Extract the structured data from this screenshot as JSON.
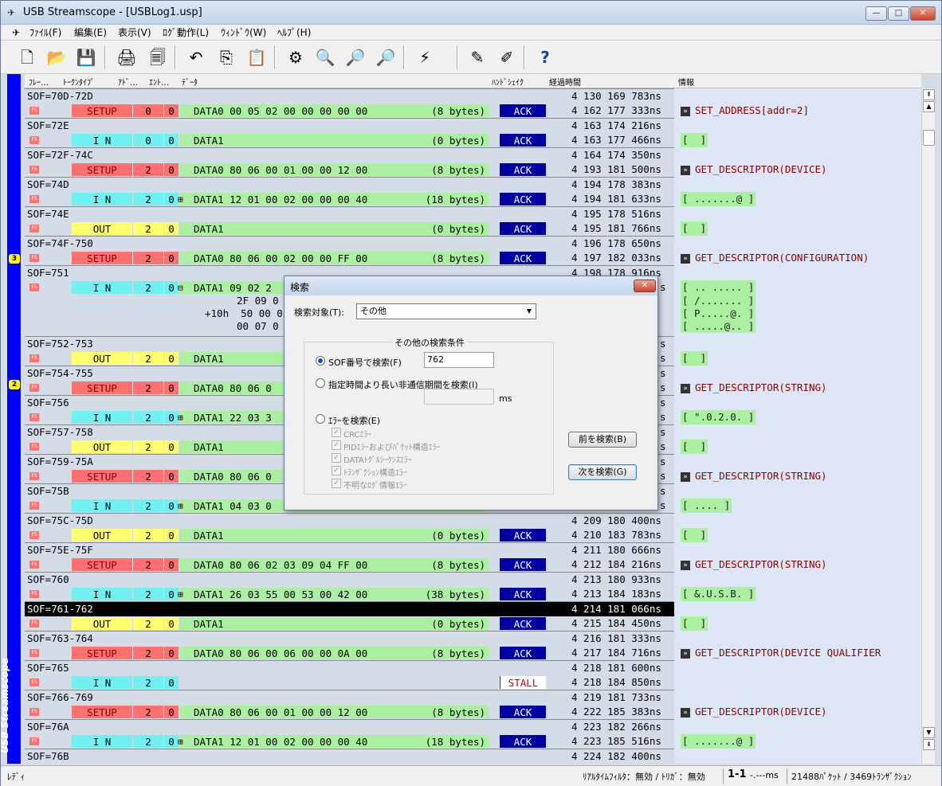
{
  "window": {
    "title": "USB Streamscope - [USBLog1.usp]",
    "min": "—",
    "max": "□",
    "close": "✕"
  },
  "menu": [
    "ﾌｧｲﾙ(F)",
    "編集(E)",
    "表示(V)",
    "ﾛｸﾞ動作(L)",
    "ｳｨﾝﾄﾞｳ(W)",
    "ﾍﾙﾌﾟ(H)"
  ],
  "mdi": {
    "min": "_",
    "restore": "❐",
    "close": "×"
  },
  "toolbar": {
    "icons": [
      "new-icon",
      "open-icon",
      "save-icon",
      "print-icon",
      "print-preview-icon",
      "undo-icon",
      "copy-icon",
      "paste-icon",
      "settings-icon",
      "search-icon",
      "find-prev-icon",
      "find-next-icon",
      "trigger-icon",
      "start-log-icon",
      "stop-log-icon",
      "help-icon"
    ],
    "glyphs": [
      "🗋",
      "📂",
      "💾",
      "🖨",
      "🗐",
      "↶",
      "⎘",
      "📋",
      "⚙",
      "🔍",
      "🔎",
      "🔎",
      "⚡",
      "✎",
      "✐",
      "?"
    ]
  },
  "sidebar": {
    "label": "USB Streamscope",
    "marks": [
      "3",
      "2"
    ]
  },
  "columns": [
    "ﾌﾚｰ…",
    "ﾄｰｸﾝﾀｲﾌﾟ",
    "ｱﾄﾞ…",
    "ｴﾝﾄ…",
    "ﾃﾞｰﾀ",
    "ﾊﾝﾄﾞｼｪｲｸ",
    "経過時間",
    "情報"
  ],
  "fs_label": "FS",
  "rows": [
    {
      "sof": "SOF=70D-72D",
      "t1": "4 130 169 783ns",
      "pid": "SETUP",
      "addr": "0",
      "endp": "0",
      "data": "DATA0 00 05 02 00 00 00 00 00",
      "len": "(8 bytes)",
      "hs": "ACK",
      "t2": "4 162 177 333ns",
      "info": "SET_ADDRESS[addr=2]",
      "kind": "req"
    },
    {
      "sof": "SOF=72E",
      "t1": "4 163 174 216ns",
      "pid": "I N",
      "addr": "0",
      "endp": "0",
      "data": "DATA1",
      "len": "(0 bytes)",
      "hs": "ACK",
      "t2": "4 163 177 466ns",
      "info": "[  ]",
      "kind": "bytes"
    },
    {
      "sof": "SOF=72F-74C",
      "t1": "4 164 174 350ns",
      "pid": "SETUP",
      "addr": "2",
      "endp": "0",
      "data": "DATA0 80 06 00 01 00 00 12 00",
      "len": "(8 bytes)",
      "hs": "ACK",
      "t2": "4 193 181 500ns",
      "info": "GET_DESCRIPTOR(DEVICE)",
      "kind": "req"
    },
    {
      "sof": "SOF=74D",
      "t1": "4 194 178 383ns",
      "pid": "I N",
      "addr": "2",
      "endp": "0",
      "data": "DATA1 12 01 00 02 00 00 00 40",
      "len": "(18 bytes)",
      "hs": "ACK",
      "t2": "4 194 181 633ns",
      "info": "[ .......@ ]",
      "kind": "bytes",
      "exp": "⊞"
    },
    {
      "sof": "SOF=74E",
      "t1": "4 195 178 516ns",
      "pid": "OUT",
      "addr": "2",
      "endp": "0",
      "data": "DATA1",
      "len": "(0 bytes)",
      "hs": "ACK",
      "t2": "4 195 181 766ns",
      "info": "[  ]",
      "kind": "bytes"
    },
    {
      "sof": "SOF=74F-750",
      "t1": "4 196 178 650ns",
      "pid": "SETUP",
      "addr": "2",
      "endp": "0",
      "data": "DATA0 80 06 00 02 00 00 FF 00",
      "len": "(8 bytes)",
      "hs": "ACK",
      "t2": "4 197 182 033ns",
      "info": "GET_DESCRIPTOR(CONFIGURATION)",
      "kind": "req"
    },
    {
      "sof": "SOF=751",
      "t1": "4 198 178 916ns",
      "pid": "I N",
      "addr": "2",
      "endp": "0",
      "data": "DATA1 09 02 2",
      "len": "",
      "hs": "",
      "t2": "s",
      "info": "[ .. ..... ]",
      "kind": "bytes",
      "exp": "⊟"
    },
    {
      "sof": "SOF=752-753",
      "t1": "s",
      "pid": "OUT",
      "addr": "2",
      "endp": "0",
      "data": "DATA1",
      "len": "",
      "hs": "",
      "t2": "s",
      "info": "[  ]",
      "kind": "bytes"
    },
    {
      "sof": "SOF=754-755",
      "t1": "s",
      "pid": "SETUP",
      "addr": "2",
      "endp": "0",
      "data": "DATA0 80 06 0",
      "len": "",
      "hs": "",
      "t2": "s",
      "info": "GET_DESCRIPTOR(STRING)",
      "kind": "req"
    },
    {
      "sof": "SOF=756",
      "t1": "s",
      "pid": "I N",
      "addr": "2",
      "endp": "0",
      "data": "DATA1 22 03 3",
      "len": "",
      "hs": "",
      "t2": "s",
      "info": "[ \".0.2.0. ]",
      "kind": "bytes",
      "exp": "⊞"
    },
    {
      "sof": "SOF=757-758",
      "t1": "s",
      "pid": "OUT",
      "addr": "2",
      "endp": "0",
      "data": "DATA1",
      "len": "",
      "hs": "",
      "t2": "s",
      "info": "[  ]",
      "kind": "bytes"
    },
    {
      "sof": "SOF=759-75A",
      "t1": "s",
      "pid": "SETUP",
      "addr": "2",
      "endp": "0",
      "data": "DATA0 80 06 0",
      "len": "",
      "hs": "",
      "t2": "s",
      "info": "GET_DESCRIPTOR(STRING)",
      "kind": "req"
    },
    {
      "sof": "SOF=75B",
      "t1": "s",
      "pid": "I N",
      "addr": "2",
      "endp": "0",
      "data": "DATA1 04 03 0",
      "len": "",
      "hs": "",
      "t2": "s",
      "info": "[ .... ]",
      "kind": "bytes",
      "exp": "⊞"
    },
    {
      "sof": "SOF=75C-75D",
      "t1": "4 209 180 400ns",
      "pid": "OUT",
      "addr": "2",
      "endp": "0",
      "data": "DATA1",
      "len": "(0 bytes)",
      "hs": "ACK",
      "t2": "4 210 183 783ns",
      "info": "[  ]",
      "kind": "bytes"
    },
    {
      "sof": "SOF=75E-75F",
      "t1": "4 211 180 666ns",
      "pid": "SETUP",
      "addr": "2",
      "endp": "0",
      "data": "DATA0 80 06 02 03 09 04 FF 00",
      "len": "(8 bytes)",
      "hs": "ACK",
      "t2": "4 212 184 216ns",
      "info": "GET_DESCRIPTOR(STRING)",
      "kind": "req"
    },
    {
      "sof": "SOF=760",
      "t1": "4 213 180 933ns",
      "pid": "I N",
      "addr": "2",
      "endp": "0",
      "data": "DATA1 26 03 55 00 53 00 42 00",
      "len": "(38 bytes)",
      "hs": "ACK",
      "t2": "4 213 184 183ns",
      "info": "[ &.U.S.B. ]",
      "kind": "bytes",
      "exp": "⊞"
    },
    {
      "sof": "SOF=761-762",
      "t1": "4 214 181 066ns",
      "pid": "OUT",
      "addr": "2",
      "endp": "0",
      "data": "DATA1",
      "len": "(0 bytes)",
      "hs": "ACK",
      "t2": "4 215 184 450ns",
      "info": "[  ]",
      "kind": "bytes",
      "sel": true
    },
    {
      "sof": "SOF=763-764",
      "t1": "4 216 181 333ns",
      "pid": "SETUP",
      "addr": "2",
      "endp": "0",
      "data": "DATA0 80 06 00 06 00 00 0A 00",
      "len": "(8 bytes)",
      "hs": "ACK",
      "t2": "4 217 184 716ns",
      "info": "GET_DESCRIPTOR(DEVICE QUALIFIER",
      "kind": "req"
    },
    {
      "sof": "SOF=765",
      "t1": "4 218 181 600ns",
      "pid": "I N",
      "addr": "2",
      "endp": "0",
      "data": "",
      "len": "",
      "hs": "STALL",
      "t2": "4 218 184 850ns",
      "info": "",
      "kind": "none"
    },
    {
      "sof": "SOF=766-769",
      "t1": "4 219 181 733ns",
      "pid": "SETUP",
      "addr": "2",
      "endp": "0",
      "data": "DATA0 80 06 00 01 00 00 12 00",
      "len": "(8 bytes)",
      "hs": "ACK",
      "t2": "4 222 185 383ns",
      "info": "GET_DESCRIPTOR(DEVICE)",
      "kind": "req"
    },
    {
      "sof": "SOF=76A",
      "t1": "4 223 182 266ns",
      "pid": "I N",
      "addr": "2",
      "endp": "0",
      "data": "DATA1 12 01 00 02 00 00 00 40",
      "len": "(18 bytes)",
      "hs": "ACK",
      "t2": "4 223 185 516ns",
      "info": "[ .......@ ]",
      "kind": "bytes",
      "exp": "⊞"
    },
    {
      "sof": "SOF=76B",
      "t1": "4 224 182 400ns",
      "pid": "",
      "addr": "",
      "endp": "",
      "data": "",
      "len": "",
      "hs": "",
      "t2": "",
      "info": "",
      "kind": "none"
    }
  ],
  "expanded": {
    "lines": [
      "2F 09 0",
      "+10h  50 00 0",
      "00 07 0"
    ],
    "info": [
      "[ /....... ]",
      "[ P.....@. ]",
      "[ .....@.. ]"
    ]
  },
  "scroll": {
    "top": "⇞",
    "up": "▲",
    "down": "▼",
    "bottom": "⇟"
  },
  "status": {
    "ready": "ﾚﾃﾞｨ",
    "filter": "ﾘｱﾙﾀｲﾑﾌｨﾙﾀ：無効 / ﾄﾘｶﾞ：無効",
    "range": "1-1",
    "ms": "-.---ms",
    "counts": "21488ﾊﾟｹｯﾄ / 3469ﾄﾗﾝｻﾞｸｼｮﾝ"
  },
  "dialog": {
    "title": "検索",
    "close": "✕",
    "target_label": "検索対象(T):",
    "target_value": "その他",
    "dd": "▼",
    "group_title": "その他の検索条件",
    "opt_sof": "SOF番号で検索(F)",
    "sof_value": "762",
    "opt_idle": "指定時間より長い非通信期間を検索(I)",
    "ms": "ms",
    "opt_err": "ｴﾗｰを検索(E)",
    "checks": [
      "CRCｴﾗｰ",
      "PIDｴﾗｰおよびﾊﾟｹｯﾄ構造ｴﾗｰ",
      "DATAﾄｸﾞﾙｼｰｹﾝｽｴﾗｰ",
      "ﾄﾗﾝｻﾞｸｼｮﾝ構造ｴﾗｰ",
      "不明なﾛｸﾞ情報ｴﾗｰ"
    ],
    "check_mark": "✓",
    "prev": "前を検索(B)",
    "next": "次を検索(G)"
  }
}
